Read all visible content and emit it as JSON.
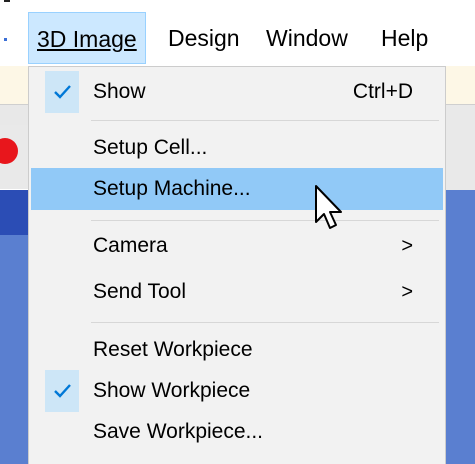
{
  "menubar": {
    "items": [
      {
        "label": "3D Image",
        "active": true
      },
      {
        "label": "Design"
      },
      {
        "label": "Window"
      },
      {
        "label": "Help"
      }
    ]
  },
  "dropdown": {
    "items": [
      {
        "label": "Show",
        "shortcut": "Ctrl+D",
        "checked": true
      },
      {
        "label": "Setup Cell..."
      },
      {
        "label": "Setup Machine...",
        "highlighted": true
      },
      {
        "label": "Camera",
        "submenu": true,
        "arrow": ">"
      },
      {
        "label": "Send Tool",
        "submenu": true,
        "arrow": ">"
      },
      {
        "label": "Reset Workpiece"
      },
      {
        "label": "Show Workpiece",
        "checked": true
      },
      {
        "label": "Save Workpiece..."
      }
    ]
  },
  "colors": {
    "highlight": "#91c9f7",
    "check_bg": "#cde6f7",
    "active_title_bg": "#cce8ff",
    "check_mark": "#0078d7"
  },
  "icons": {
    "check": "checkmark-icon",
    "submenu": "chevron-right-icon",
    "cursor": "mouse-pointer-icon"
  }
}
